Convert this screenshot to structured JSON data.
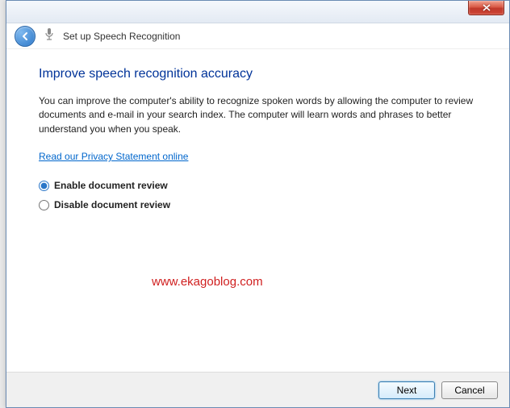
{
  "window": {
    "title": "Set up Speech Recognition"
  },
  "page": {
    "heading": "Improve speech recognition accuracy",
    "body": "You can improve the computer's ability to recognize spoken words by allowing the computer to review documents and e-mail in your search index. The computer will learn words and phrases to better understand you when you speak.",
    "privacy_link": "Read our Privacy Statement online"
  },
  "options": {
    "enable_label": "Enable document review",
    "disable_label": "Disable document review",
    "selected": "enable"
  },
  "footer": {
    "next_label": "Next",
    "cancel_label": "Cancel"
  },
  "watermark": "www.ekagoblog.com"
}
